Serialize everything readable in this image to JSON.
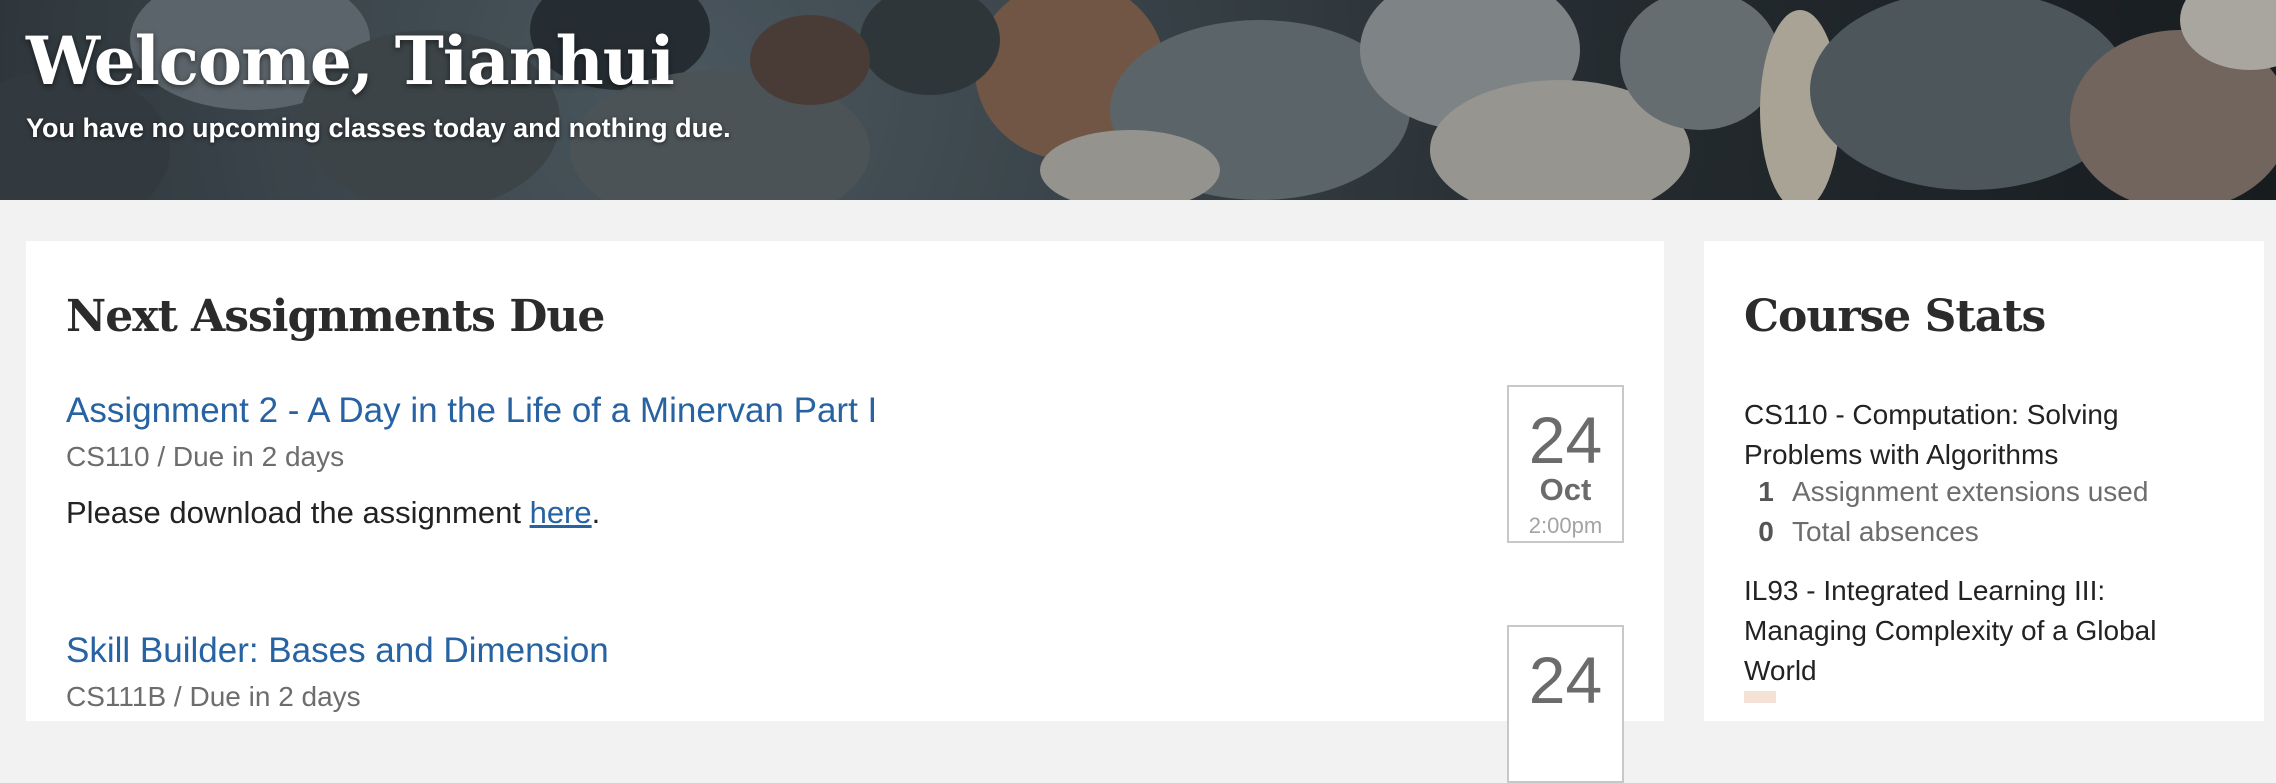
{
  "hero": {
    "title": "Welcome, Tianhui",
    "subtitle": "You have no upcoming classes today and nothing due."
  },
  "assignments": {
    "title": "Next Assignments Due",
    "items": [
      {
        "title": "Assignment 2 - A Day in the Life of a Minervan Part I",
        "meta": "CS110 / Due in 2 days",
        "desc_before": "Please download the assignment ",
        "desc_link": "here",
        "desc_after": ".",
        "date_day": "24",
        "date_month": "Oct",
        "date_time": "2:00pm"
      },
      {
        "title": "Skill Builder: Bases and Dimension",
        "meta": "CS111B / Due in 2 days",
        "date_day": "24"
      }
    ]
  },
  "stats": {
    "title": "Course Stats",
    "courses": [
      {
        "name": "CS110 - Computation: Solving Problems with Algorithms",
        "rows": [
          {
            "value": "1",
            "label": "Assignment extensions used"
          },
          {
            "value": "0",
            "label": "Total absences"
          }
        ]
      },
      {
        "name": "IL93 - Integrated Learning III: Managing Complexity of a Global World"
      }
    ]
  },
  "colors": {
    "link": "#2762a2",
    "page_bg": "#f2f2f2",
    "card_bg": "#ffffff"
  }
}
